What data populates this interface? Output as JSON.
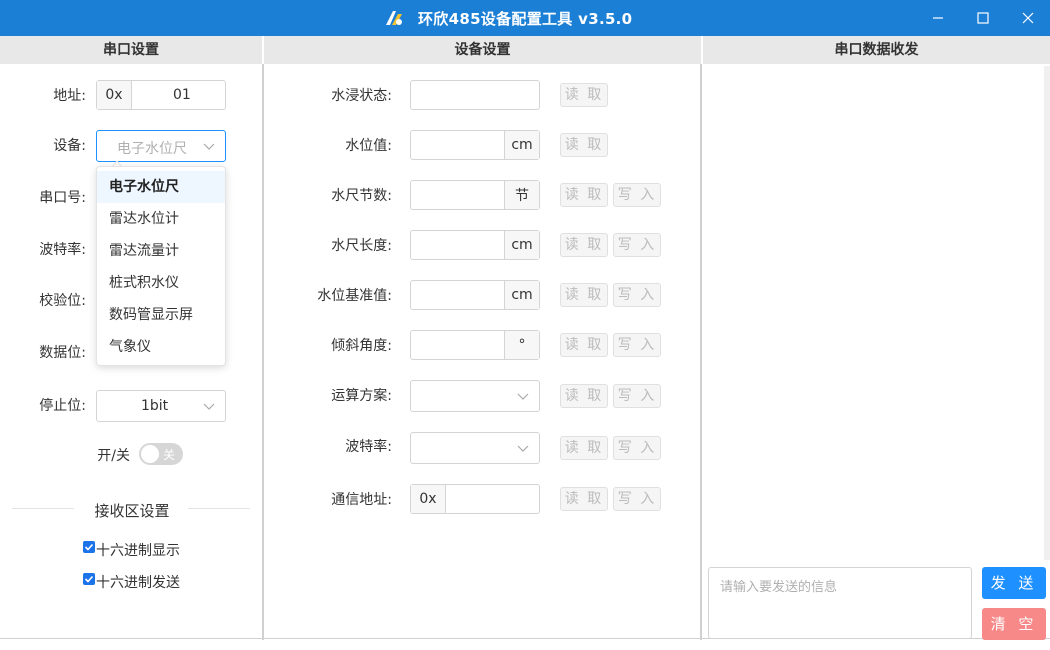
{
  "window": {
    "title": "环欣485设备配置工具 v3.5.0",
    "icons": {
      "app": "app-logo-icon",
      "minimize": "minimize-icon",
      "maximize": "maximize-icon",
      "close": "close-icon"
    }
  },
  "sections": {
    "serial": "串口设置",
    "device": "设备设置",
    "data": "串口数据收发"
  },
  "serial": {
    "address_label": "地址:",
    "address_prefix": "0x",
    "address_value": "01",
    "device_label": "设备:",
    "device_placeholder": "电子水位尺",
    "port_label": "串口号:",
    "baud_label": "波特率:",
    "parity_label": "校验位:",
    "databits_label": "数据位:",
    "stopbits_label": "停止位:",
    "stopbits_value": "1bit",
    "switch_label": "开/关",
    "switch_state": "关",
    "device_options": [
      "电子水位尺",
      "雷达水位计",
      "雷达流量计",
      "桩式积水仪",
      "数码管显示屏",
      "气象仪"
    ],
    "device_selected": "电子水位尺"
  },
  "receive": {
    "heading": "接收区设置",
    "hex_display": "十六进制显示",
    "hex_send": "十六进制发送",
    "hex_display_checked": true,
    "hex_send_checked": true
  },
  "device": {
    "read_label": "读 取",
    "write_label": "写 入",
    "rows": [
      {
        "label": "水浸状态:",
        "unit": ""
      },
      {
        "label": "水位值:",
        "unit": "cm"
      },
      {
        "label": "水尺节数:",
        "unit": "节"
      },
      {
        "label": "水尺长度:",
        "unit": "cm"
      },
      {
        "label": "水位基准值:",
        "unit": "cm"
      },
      {
        "label": "倾斜角度:",
        "unit": "°"
      },
      {
        "label": "运算方案:",
        "unit": ""
      },
      {
        "label": "波特率:",
        "unit": ""
      },
      {
        "label": "通信地址:",
        "prefix": "0x"
      }
    ]
  },
  "data": {
    "send_placeholder": "请输入要发送的信息",
    "send_label": "发 送",
    "clear_label": "清 空",
    "colors": {
      "send": "#1e90ff",
      "clear": "#f78989",
      "titlebar": "#1c7fd6"
    }
  }
}
